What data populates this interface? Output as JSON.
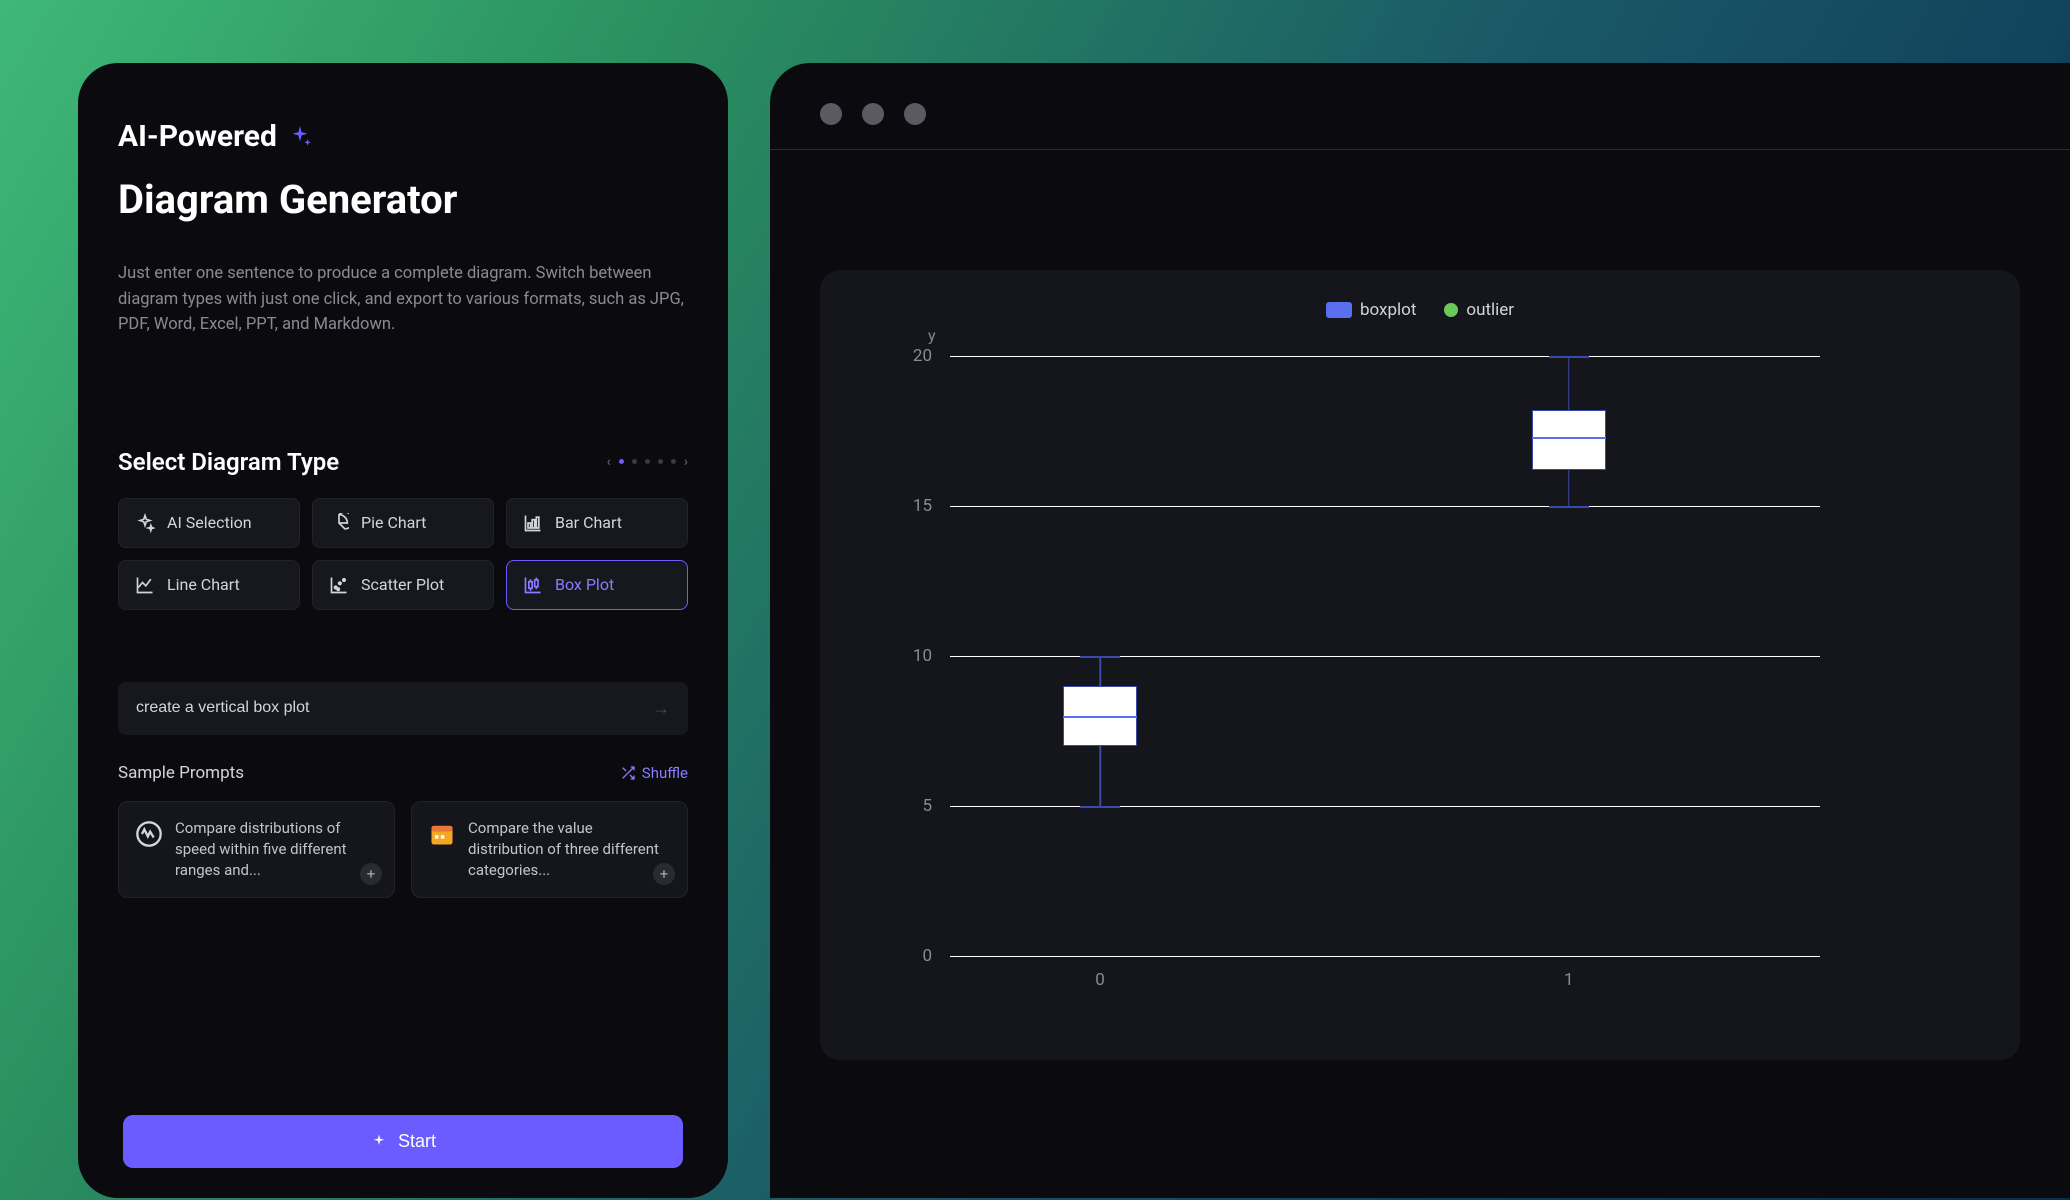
{
  "left": {
    "ai_tag": "AI-Powered",
    "title": "Diagram Generator",
    "description": "Just enter one sentence to produce a complete diagram. Switch between diagram types with just one click, and export to various formats, such as JPG, PDF, Word, Excel, PPT, and Markdown.",
    "section_title": "Select Diagram Type",
    "chips": {
      "ai": "AI Selection",
      "pie": "Pie Chart",
      "bar": "Bar Chart",
      "line": "Line Chart",
      "scatter": "Scatter Plot",
      "box": "Box Plot"
    },
    "prompt_value": "create a vertical box plot",
    "sample_title": "Sample Prompts",
    "shuffle_label": "Shuffle",
    "samples": {
      "s1": "Compare distributions of speed within five different ranges and...",
      "s2": "Compare the value distribution of three different categories..."
    },
    "start_label": "Start"
  },
  "chart_data": {
    "type": "box",
    "ylabel": "y",
    "legend": {
      "boxplot": "boxplot",
      "outlier": "outlier"
    },
    "y_ticks": [
      0,
      5,
      10,
      15,
      20
    ],
    "x_ticks": [
      0,
      1
    ],
    "ylim": [
      0,
      20
    ],
    "series": [
      {
        "category": 0,
        "min": 5,
        "q1": 7.0,
        "median": 8.0,
        "q3": 9.0,
        "max": 10
      },
      {
        "category": 1,
        "min": 15,
        "q1": 16.2,
        "median": 17.3,
        "q3": 18.2,
        "max": 20
      }
    ]
  }
}
